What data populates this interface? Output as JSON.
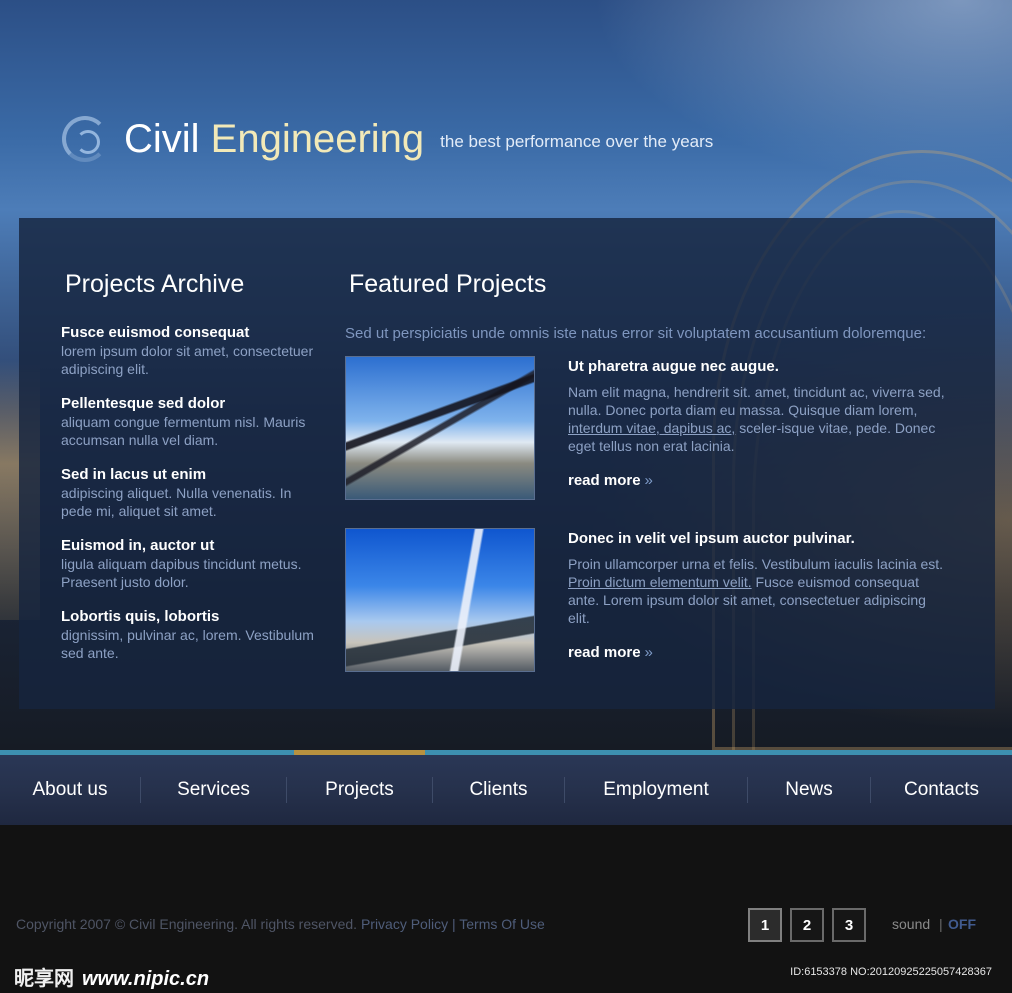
{
  "header": {
    "title_part1": "Civil ",
    "title_part2": "Engineering",
    "tagline": "the best performance over the years"
  },
  "archive": {
    "heading": "Projects Archive",
    "items": [
      {
        "title": "Fusce euismod consequat",
        "text": "lorem ipsum dolor sit amet, consectetuer adipiscing elit."
      },
      {
        "title": "Pellentesque sed dolor",
        "text": "aliquam congue fermentum nisl. Mauris accumsan nulla vel diam."
      },
      {
        "title": "Sed in lacus ut enim",
        "text": "adipiscing aliquet. Nulla venenatis. In pede mi, aliquet sit amet."
      },
      {
        "title": "Euismod in, auctor ut",
        "text": "ligula aliquam dapibus tincidunt metus. Praesent justo dolor."
      },
      {
        "title": "Lobortis quis, lobortis",
        "text": "dignissim, pulvinar ac, lorem. Vestibulum sed ante."
      }
    ]
  },
  "featured": {
    "heading": "Featured Projects",
    "intro": "Sed ut perspiciatis unde omnis iste natus error sit voluptatem accusantium doloremque:",
    "projects": [
      {
        "title": "Ut pharetra augue nec augue.",
        "text_a": "Nam elit magna, hendrerit sit. amet, tincidunt ac, viverra sed, nulla. Donec porta diam eu massa. Quisque diam lorem, ",
        "link": "interdum vitae, dapibus ac,",
        "text_b": " sceler-isque vitae, pede. Donec eget tellus non erat lacinia.",
        "read_more": "read more",
        "arrow": "»"
      },
      {
        "title": "Donec in velit vel ipsum auctor pulvinar.",
        "text_a": "Proin ullamcorper urna et felis. Vestibulum iaculis lacinia est. ",
        "link": "Proin dictum elementum velit.",
        "text_b": " Fusce euismod consequat ante. Lorem ipsum dolor sit amet, consectetuer adipiscing elit.",
        "read_more": "read more",
        "arrow": "»"
      }
    ]
  },
  "nav": {
    "items": [
      "About us",
      "Services",
      "Projects",
      "Clients",
      "Employment",
      "News",
      "Contacts"
    ],
    "active": "Projects"
  },
  "footer": {
    "copyright": "Copyright 2007 © Civil Engineering. All rights reserved.",
    "privacy": "Privacy Policy",
    "sep": "|",
    "terms": "Terms Of Use",
    "pages": [
      "1",
      "2",
      "3"
    ],
    "sound_label": "sound",
    "sound_sep": "|",
    "sound_state": "OFF"
  },
  "watermark": {
    "left_cn": "昵享网",
    "left_url": "www.nipic.cn",
    "right": "ID:6153378 NO:20120925225057428367"
  },
  "colors": {
    "panel": "#16243e",
    "nav_active_accent": "#b8913f",
    "nav_accent": "#3d8fb0",
    "sound_off": "#415b8f"
  }
}
